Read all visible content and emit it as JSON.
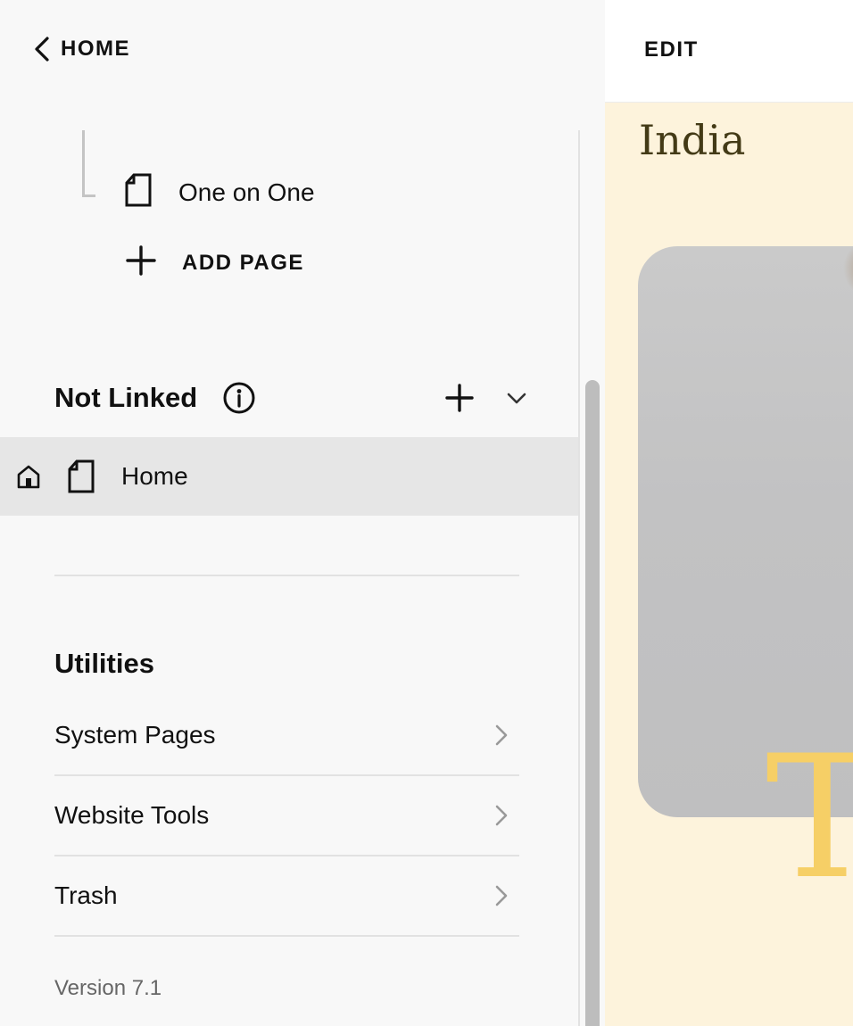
{
  "sidebar": {
    "back_label": "HOME",
    "child_page": {
      "label": "One on One"
    },
    "add_page_label": "ADD PAGE",
    "not_linked": {
      "title": "Not Linked",
      "items": [
        {
          "label": "Home"
        }
      ]
    },
    "utilities": {
      "title": "Utilities",
      "items": [
        {
          "label": "System Pages"
        },
        {
          "label": "Website Tools"
        },
        {
          "label": "Trash"
        }
      ]
    },
    "version": "Version 7.1"
  },
  "preview": {
    "edit_label": "EDIT",
    "heading": "India",
    "hero_letter": "T",
    "colors": {
      "background": "#fdf3dc",
      "heading": "#433a16",
      "accent_letter": "#f6cf66"
    }
  },
  "icons": [
    "chevron-left-icon",
    "page-icon",
    "plus-icon",
    "info-icon",
    "chevron-down-icon",
    "home-icon",
    "chevron-right-icon"
  ]
}
